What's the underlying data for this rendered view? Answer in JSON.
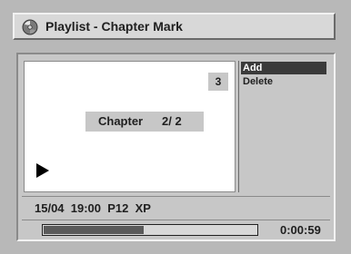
{
  "header": {
    "title": "Playlist - Chapter Mark",
    "icon": "disc-icon"
  },
  "preview": {
    "chapter_count": "3",
    "chapter_label": "Chapter",
    "chapter_value": "2/ 2",
    "play_icon": "play-icon"
  },
  "menu": {
    "items": [
      {
        "label": "Add",
        "selected": true
      },
      {
        "label": "Delete",
        "selected": false
      }
    ]
  },
  "info": {
    "recording": "15/04  19:00  P12  XP"
  },
  "playback": {
    "progress_fraction": 0.47,
    "time": "0:00:59"
  },
  "colors": {
    "background": "#b8b8b8",
    "panel": "#c7c7c7",
    "highlight": "#3a3a3a",
    "progress_fill": "#5a5a5a"
  }
}
